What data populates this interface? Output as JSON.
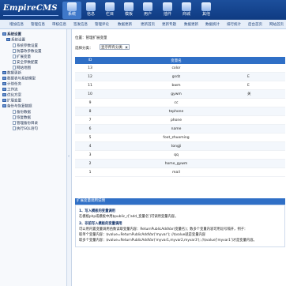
{
  "header": {
    "logo": "EmpireCMS",
    "nav": [
      {
        "label": "系统",
        "icon": "system-icon",
        "active": true
      },
      {
        "label": "信息",
        "icon": "info-icon"
      },
      {
        "label": "栏目",
        "icon": "column-icon"
      },
      {
        "label": "模板",
        "icon": "template-icon"
      },
      {
        "label": "用户",
        "icon": "user-icon"
      },
      {
        "label": "插件",
        "icon": "plugin-icon"
      },
      {
        "label": "商城",
        "icon": "shop-icon"
      },
      {
        "label": "其他",
        "icon": "other-icon"
      }
    ]
  },
  "subnav": [
    "增加信息",
    "管理信息",
    "审核信息",
    "签发信息",
    "管理评论",
    "数据更新",
    "更新首页",
    "更新专题",
    "数据更新",
    "数据统计",
    "排行统计",
    "后台首页",
    "网站首页",
    "后台地图"
  ],
  "sidebar": {
    "root": "系统设置",
    "items": [
      {
        "label": "系统设置",
        "indent": 1,
        "icon": "folder-icon"
      },
      {
        "label": "系统参数设置",
        "indent": 2,
        "icon": "page-icon"
      },
      {
        "label": "防篡改参数设置",
        "indent": 2,
        "icon": "page-icon"
      },
      {
        "label": "扩展变量",
        "indent": 2,
        "icon": "page-icon"
      },
      {
        "label": "安全参数配置",
        "indent": 2,
        "icon": "page-icon"
      },
      {
        "label": "网站地图",
        "indent": 2,
        "icon": "page-icon"
      },
      {
        "label": "数据更新",
        "indent": 1,
        "icon": "folder-icon"
      },
      {
        "label": "数据表与系统模型",
        "indent": 1,
        "icon": "folder-icon"
      },
      {
        "label": "计划任务",
        "indent": 1,
        "icon": "folder-icon"
      },
      {
        "label": "工作流",
        "indent": 1,
        "icon": "folder-icon"
      },
      {
        "label": "优化方案",
        "indent": 1,
        "icon": "folder-icon"
      },
      {
        "label": "扩展变量",
        "indent": 1,
        "icon": "folder-icon"
      },
      {
        "label": "备份与恢复数据",
        "indent": 1,
        "icon": "folder-icon"
      },
      {
        "label": "备份数据",
        "indent": 2,
        "icon": "page-icon"
      },
      {
        "label": "恢复数据",
        "indent": 2,
        "icon": "page-icon"
      },
      {
        "label": "管理备份目录",
        "indent": 2,
        "icon": "page-icon"
      },
      {
        "label": "执行SQL语句",
        "indent": 2,
        "icon": "page-icon"
      }
    ]
  },
  "splitter": "‹",
  "main": {
    "breadcrumb": "位置：管理扩展变量",
    "filter_label": "选择分类：",
    "filter_value": "显示所有分类",
    "columns": [
      "ID",
      "变量名",
      ""
    ],
    "rows": [
      {
        "id": "13",
        "name": "color",
        "extra": ""
      },
      {
        "id": "12",
        "name": "gsdz",
        "extra": "E"
      },
      {
        "id": "11",
        "name": "bwm",
        "extra": "E"
      },
      {
        "id": "10",
        "name": "gywm",
        "extra": "关"
      },
      {
        "id": "9",
        "name": "cc",
        "extra": ""
      },
      {
        "id": "8",
        "name": "tephone",
        "extra": ""
      },
      {
        "id": "7",
        "name": "phone",
        "extra": ""
      },
      {
        "id": "6",
        "name": "name",
        "extra": ""
      },
      {
        "id": "5",
        "name": "foot_zhuoming",
        "extra": ""
      },
      {
        "id": "4",
        "name": "tongji",
        "extra": ""
      },
      {
        "id": "3",
        "name": "qq",
        "extra": ""
      },
      {
        "id": "2",
        "name": "home_gywm",
        "extra": ""
      },
      {
        "id": "1",
        "name": "mail",
        "extra": ""
      }
    ]
  },
  "help": {
    "title": "扩展变量调用说明",
    "lines": [
      {
        "text": "1、写入模板的变量调用",
        "heading": true
      },
      {
        "text": "在模板php或模板中用$public_r['add_变量名']可调用变量内容。",
        "heading": false
      },
      {
        "text": "2、非前写入模板的变量调用",
        "heading": true
      },
      {
        "text": "可以用内置变量调用函数读取变量内容：ReturnPublicAddVar(变量名)；数多个变量内容可用逗号隔开，例子：",
        "heading": false
      },
      {
        "text": "取单个变量内容：$value=ReturnPublicAddVar('myvar'); //$value就是变量内容",
        "heading": false
      },
      {
        "text": "取多个变量内容：$value=ReturnPublicAddVar('myvar1,myvar2,myvar3'); //$value['myvar1']才是变量内容。",
        "heading": false
      }
    ]
  }
}
